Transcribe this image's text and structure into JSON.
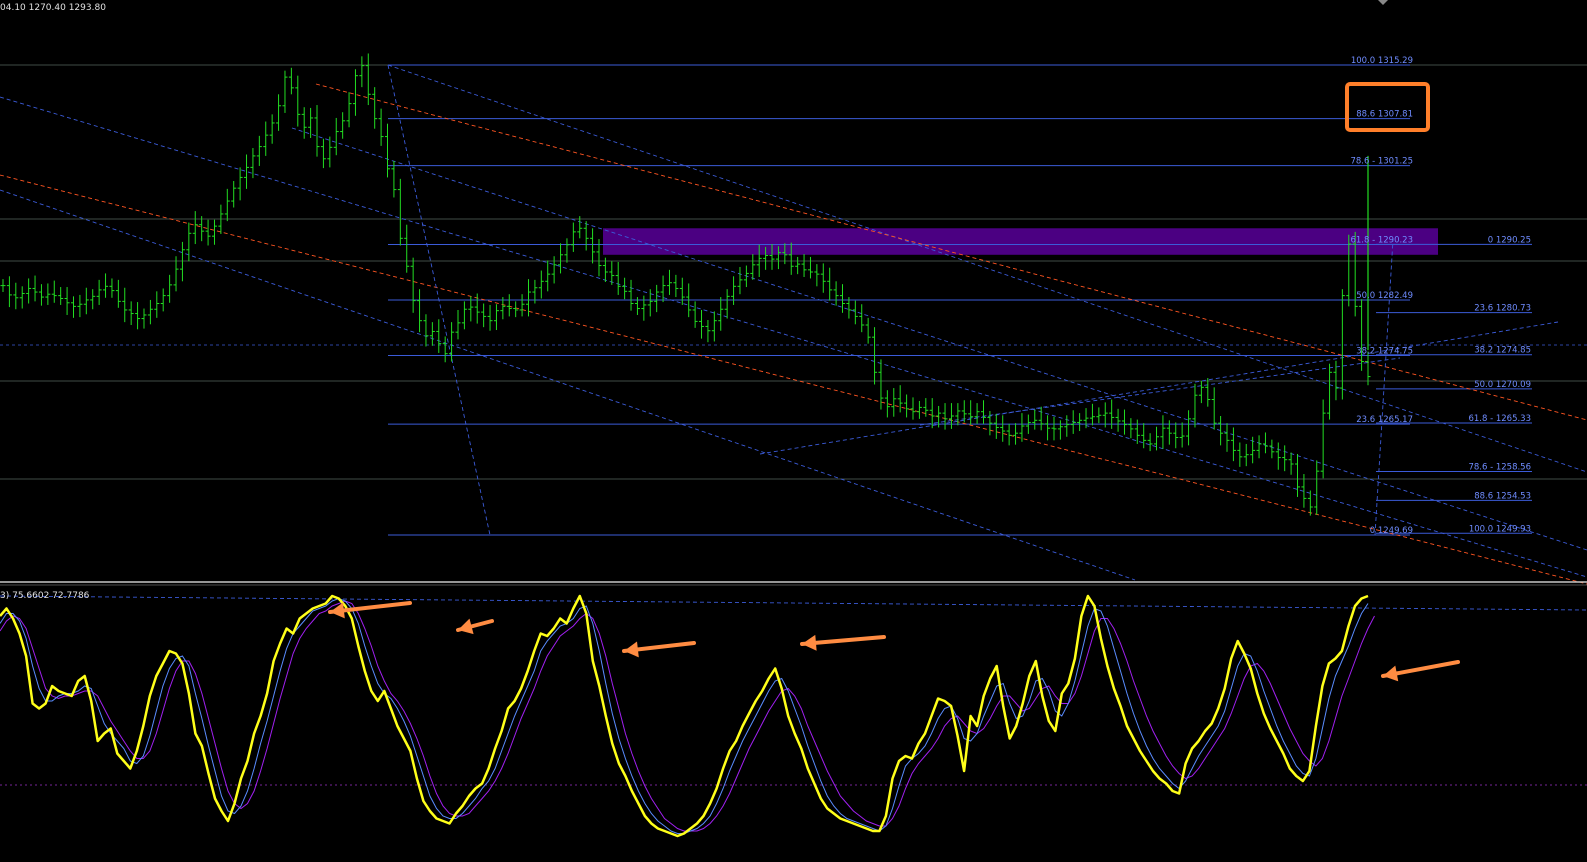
{
  "header": {
    "ohlc_text": "04.10 1270.40 1293.80"
  },
  "stoch_panel": {
    "label": "3) 75.6602 72.7786"
  },
  "colors": {
    "background": "#000000",
    "candle": "#22dd22",
    "fib_line": "#3b5bd8",
    "fib_label": "#6f8cff",
    "channel_blue": "#3b5bd8",
    "channel_red": "#ff5522",
    "zone": "#4b0082",
    "highlight_box": "#ff7f2a",
    "arrow": "#ff8c42",
    "stoch_main": "#ffff1a",
    "stoch_signal_blue": "#5a8cff",
    "stoch_signal_purple": "#a020f0",
    "panel_divider": "#c8c8c8"
  },
  "chart_data": [
    {
      "type": "candlestick",
      "title": "",
      "ylim": [
        1245,
        1325
      ],
      "fib_retracement_left": [
        {
          "label": "100.0 1315.29",
          "price": 1315.29
        },
        {
          "label": "88.6 1307.81",
          "price": 1307.81
        },
        {
          "label": "78.6 - 1301.25",
          "price": 1301.25
        },
        {
          "label": "61.8 - 1290.23",
          "price": 1290.23
        },
        {
          "label": "50.0 1282.49",
          "price": 1282.49
        },
        {
          "label": "38.2 1274.75",
          "price": 1274.75
        },
        {
          "label": "23.6 1265.17",
          "price": 1265.17
        },
        {
          "label": "0 1249.69",
          "price": 1249.69
        }
      ],
      "fib_retracement_right": [
        {
          "label": "0 1290.25",
          "price": 1290.25
        },
        {
          "label": "23.6 1280.73",
          "price": 1280.73
        },
        {
          "label": "38.2 1274.85",
          "price": 1274.85
        },
        {
          "label": "50.0 1270.09",
          "price": 1270.09
        },
        {
          "label": "61.8 - 1265.33",
          "price": 1265.33
        },
        {
          "label": "78.6 - 1258.56",
          "price": 1258.56
        },
        {
          "label": "88.6 1254.53",
          "price": 1254.53
        },
        {
          "label": "100.0 1249.93",
          "price": 1249.93
        }
      ],
      "highlighted_level": "88.6 1307.81",
      "supply_zone": {
        "from": 1288.8,
        "to": 1292.5
      },
      "close_series": [
        1284.5,
        1283.2,
        1282.8,
        1283.4,
        1284.1,
        1283.6,
        1282.9,
        1283.3,
        1283.1,
        1282.7,
        1282.1,
        1281.6,
        1281.9,
        1282.5,
        1283.0,
        1283.9,
        1284.4,
        1283.8,
        1282.3,
        1281.1,
        1280.6,
        1279.9,
        1280.4,
        1281.2,
        1282.0,
        1283.1,
        1284.6,
        1286.8,
        1289.5,
        1291.8,
        1293.0,
        1292.1,
        1291.4,
        1292.8,
        1294.5,
        1296.3,
        1298.1,
        1299.6,
        1301.0,
        1302.6,
        1303.9,
        1305.5,
        1307.2,
        1309.6,
        1313.6,
        1312.1,
        1308.4,
        1306.6,
        1307.9,
        1303.9,
        1302.2,
        1303.8,
        1306.0,
        1307.5,
        1309.9,
        1313.8,
        1315.2,
        1311.2,
        1307.8,
        1305.3,
        1300.8,
        1297.9,
        1291.1,
        1287.2,
        1282.4,
        1279.6,
        1277.5,
        1278.1,
        1276.4,
        1275.0,
        1278.0,
        1279.3,
        1281.2,
        1281.5,
        1280.8,
        1280.2,
        1279.6,
        1281.0,
        1281.6,
        1281.3,
        1281.1,
        1281.9,
        1283.6,
        1284.2,
        1285.1,
        1286.1,
        1287.4,
        1288.8,
        1290.2,
        1292.0,
        1292.5,
        1291.1,
        1289.2,
        1287.3,
        1286.4,
        1285.9,
        1284.4,
        1283.7,
        1282.0,
        1281.3,
        1281.8,
        1282.3,
        1283.6,
        1284.5,
        1284.9,
        1284.1,
        1282.9,
        1281.1,
        1279.5,
        1278.8,
        1278.2,
        1279.6,
        1281.2,
        1283.0,
        1284.4,
        1285.3,
        1286.2,
        1287.4,
        1288.3,
        1288.7,
        1288.2,
        1289.1,
        1288.8,
        1287.2,
        1287.5,
        1286.7,
        1286.4,
        1286.1,
        1285.1,
        1283.9,
        1283.1,
        1282.0,
        1281.1,
        1280.2,
        1279.0,
        1277.3,
        1272.4,
        1268.8,
        1267.6,
        1268.7,
        1268.1,
        1267.3,
        1266.9,
        1267.5,
        1267.1,
        1266.3,
        1266.7,
        1265.9,
        1266.3,
        1267.0,
        1266.6,
        1266.2,
        1266.9,
        1266.1,
        1265.3,
        1264.7,
        1264.2,
        1263.6,
        1263.9,
        1264.9,
        1265.4,
        1265.7,
        1265.2,
        1264.6,
        1264.5,
        1264.8,
        1265.1,
        1265.4,
        1265.7,
        1266.0,
        1266.2,
        1266.4,
        1266.7,
        1266.1,
        1265.6,
        1265.1,
        1264.5,
        1263.6,
        1262.9,
        1262.4,
        1263.4,
        1264.6,
        1263.9,
        1263.3,
        1263.5,
        1265.9,
        1269.2,
        1270.3,
        1268.6,
        1265.3,
        1263.9,
        1262.9,
        1261.5,
        1260.6,
        1260.9,
        1261.5,
        1262.4,
        1262.1,
        1261.3,
        1260.5,
        1260.2,
        1259.6,
        1256.4,
        1254.8,
        1253.6,
        1258.6,
        1266.7,
        1272.4,
        1270.2,
        1283.1,
        1290.3,
        1281.6,
        1273.9,
        1271.8
      ],
      "stochastic": {
        "label": "3) 75.6602 72.7786",
        "ylim": [
          0,
          100
        ],
        "levels": [
          80,
          20
        ],
        "main_k": [
          92,
          95,
          91,
          85,
          76,
          57,
          55,
          57,
          64,
          62,
          61,
          60,
          66,
          68,
          58,
          42,
          45,
          47,
          37,
          34,
          31,
          38,
          48,
          60,
          68,
          73,
          78,
          77,
          73,
          61,
          45,
          40,
          29,
          19,
          14,
          10,
          17,
          27,
          34,
          45,
          52,
          61,
          74,
          81,
          87,
          85,
          91,
          93,
          95,
          96,
          97,
          100,
          99,
          96,
          91,
          80,
          70,
          62,
          58,
          62,
          55,
          48,
          43,
          38,
          27,
          18,
          14,
          11,
          10,
          9,
          13,
          16,
          20,
          23,
          25,
          31,
          39,
          46,
          55,
          58,
          63,
          70,
          78,
          85,
          84,
          87,
          91,
          89,
          95,
          100,
          93,
          74,
          64,
          52,
          41,
          33,
          28,
          22,
          17,
          12,
          9,
          7,
          6,
          5,
          4,
          5,
          7,
          9,
          12,
          17,
          23,
          31,
          38,
          42,
          48,
          53,
          58,
          62,
          67,
          71,
          63,
          52,
          45,
          39,
          31,
          25,
          19,
          15,
          13,
          11,
          10,
          9,
          8,
          7,
          6,
          6,
          12,
          27,
          34,
          36,
          35,
          41,
          45,
          52,
          59,
          58,
          56,
          44,
          30,
          52,
          48,
          60,
          67,
          72,
          56,
          43,
          48,
          57,
          68,
          74,
          60,
          50,
          46,
          61,
          65,
          75,
          92,
          100,
          96,
          83,
          72,
          63,
          56,
          48,
          43,
          38,
          34,
          30,
          27,
          25,
          22,
          21,
          33,
          39,
          42,
          46,
          49,
          55,
          63,
          75,
          82,
          77,
          71,
          61,
          53,
          47,
          42,
          37,
          31,
          28,
          26,
          30,
          48,
          64,
          73,
          75,
          78,
          88,
          96,
          99,
          100
        ],
        "signal_d_blue": [
          89,
          93,
          93,
          90,
          83,
          72,
          63,
          58,
          58,
          60,
          61,
          61,
          62,
          64,
          63,
          56,
          49,
          45,
          42,
          39,
          34,
          33,
          36,
          44,
          54,
          64,
          71,
          75,
          76,
          72,
          61,
          51,
          40,
          30,
          20,
          14,
          13,
          16,
          22,
          31,
          41,
          50,
          60,
          70,
          79,
          85,
          88,
          91,
          94,
          95,
          96,
          98,
          99,
          98,
          95,
          89,
          80,
          72,
          65,
          61,
          59,
          55,
          50,
          44,
          36,
          28,
          20,
          15,
          12,
          11,
          11,
          13,
          16,
          19,
          23,
          26,
          31,
          38,
          45,
          52,
          58,
          64,
          70,
          78,
          82,
          85,
          88,
          89,
          91,
          95,
          96,
          89,
          78,
          65,
          53,
          43,
          35,
          28,
          22,
          17,
          13,
          10,
          8,
          6,
          5,
          5,
          6,
          7,
          9,
          12,
          17,
          23,
          30,
          36,
          42,
          47,
          52,
          57,
          62,
          66,
          67,
          62,
          55,
          48,
          40,
          33,
          26,
          20,
          16,
          13,
          11,
          10,
          9,
          8,
          7,
          6,
          8,
          15,
          24,
          32,
          35,
          37,
          40,
          45,
          51,
          55,
          56,
          51,
          43,
          42,
          45,
          52,
          58,
          64,
          65,
          57,
          51,
          52,
          58,
          66,
          67,
          62,
          54,
          52,
          57,
          66,
          77,
          88,
          95,
          94,
          88,
          79,
          70,
          61,
          53,
          46,
          40,
          35,
          31,
          28,
          25,
          23,
          26,
          31,
          36,
          40,
          44,
          48,
          54,
          63,
          72,
          77,
          76,
          70,
          62,
          55,
          48,
          42,
          37,
          32,
          29,
          28,
          35,
          47,
          59,
          68,
          74,
          80,
          87,
          93,
          97
        ],
        "signal_d_purple": [
          86,
          90,
          92,
          91,
          87,
          79,
          71,
          63,
          60,
          59,
          60,
          60,
          61,
          62,
          62,
          60,
          55,
          50,
          46,
          42,
          38,
          35,
          35,
          38,
          45,
          54,
          63,
          70,
          74,
          74,
          69,
          61,
          51,
          41,
          31,
          22,
          17,
          15,
          17,
          22,
          30,
          39,
          49,
          59,
          68,
          77,
          83,
          87,
          90,
          93,
          94,
          96,
          97,
          98,
          97,
          93,
          87,
          80,
          72,
          66,
          61,
          58,
          54,
          49,
          43,
          36,
          28,
          21,
          16,
          13,
          12,
          12,
          13,
          16,
          19,
          22,
          26,
          31,
          37,
          44,
          51,
          57,
          63,
          70,
          76,
          80,
          84,
          86,
          88,
          91,
          93,
          91,
          85,
          76,
          65,
          55,
          45,
          37,
          30,
          24,
          19,
          15,
          11,
          9,
          7,
          6,
          6,
          6,
          7,
          9,
          12,
          16,
          21,
          27,
          33,
          39,
          44,
          49,
          54,
          58,
          62,
          63,
          60,
          55,
          48,
          42,
          36,
          30,
          25,
          20,
          17,
          14,
          12,
          10,
          9,
          8,
          8,
          11,
          16,
          23,
          29,
          33,
          36,
          39,
          43,
          48,
          51,
          52,
          49,
          46,
          45,
          47,
          51,
          56,
          60,
          60,
          57,
          54,
          55,
          59,
          63,
          64,
          60,
          57,
          57,
          61,
          68,
          77,
          86,
          91,
          91,
          87,
          81,
          74,
          66,
          59,
          52,
          46,
          41,
          36,
          32,
          29,
          27,
          28,
          31,
          35,
          39,
          43,
          47,
          53,
          60,
          67,
          72,
          73,
          70,
          65,
          59,
          53,
          47,
          42,
          37,
          34,
          32,
          35,
          42,
          51,
          60,
          67,
          74,
          81,
          87,
          92
        ]
      }
    }
  ]
}
